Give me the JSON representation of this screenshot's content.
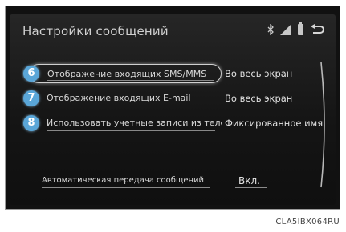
{
  "screen": {
    "title": "Настройки сообщений"
  },
  "status_icons": [
    "bluetooth-icon",
    "signal-icon",
    "battery-icon",
    "back-icon"
  ],
  "items": [
    {
      "number": "6",
      "label": "Отображение входящих SMS/MMS",
      "value": "Во весь экран",
      "selected": true
    },
    {
      "number": "7",
      "label": "Отображение входящих E-mail",
      "value": "Во весь экран",
      "selected": false
    },
    {
      "number": "8",
      "label": "Использовать учетные записи из телефона",
      "value": "Фиксированное имя",
      "selected": false
    }
  ],
  "auto": {
    "label": "Автоматическая передача сообщений",
    "value": "Вкл."
  },
  "caption": "CLA5IBX064RU",
  "colors": {
    "badge": "#5aa6d8",
    "screen_bg": "#151515",
    "text": "#d8d8d8"
  }
}
